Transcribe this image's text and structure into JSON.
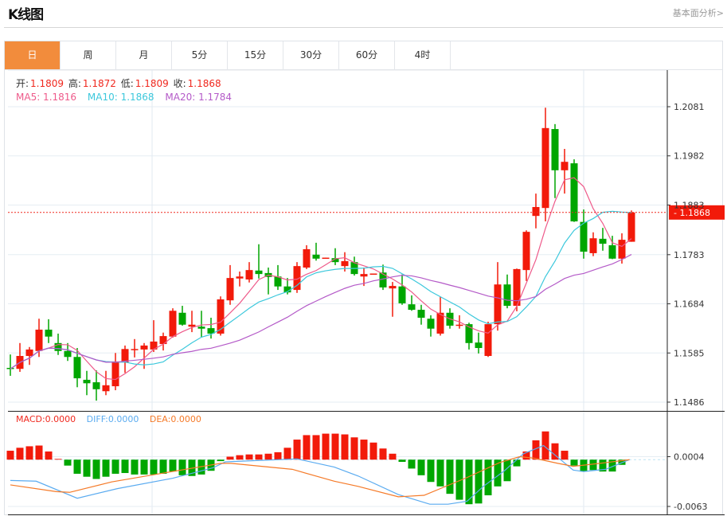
{
  "header": {
    "title": "K线图",
    "link": "基本面分析>"
  },
  "tabs": [
    {
      "label": "日",
      "active": true
    },
    {
      "label": "周"
    },
    {
      "label": "月"
    },
    {
      "label": "5分"
    },
    {
      "label": "15分"
    },
    {
      "label": "30分"
    },
    {
      "label": "60分"
    },
    {
      "label": "4时"
    }
  ],
  "ohlc_info": {
    "open_label": "开:",
    "open": "1.1809",
    "high_label": "高:",
    "high": "1.1872",
    "low_label": "低:",
    "low": "1.1809",
    "close_label": "收:",
    "close": "1.1868"
  },
  "ma_info": {
    "ma5": "MA5: 1.1816",
    "ma10": "MA10: 1.1868",
    "ma20": "MA20: 1.1784"
  },
  "macd_info": {
    "macd": "MACD:0.0000",
    "diff": "DIFF:0.0000",
    "dea": "DEA:0.0000"
  },
  "colors": {
    "up": "#f21a0a",
    "down": "#00a600",
    "ma5": "#ee5a8a",
    "ma10": "#3cc8dc",
    "ma20": "#b45ac8",
    "diff": "#5aabf0",
    "dea": "#f57a28",
    "accent": "#f28c3c"
  },
  "chart_data": [
    {
      "type": "candlestick",
      "ylim": [
        1.1486,
        1.2081
      ],
      "yticks": [
        "1.2081",
        "1.1982",
        "1.1883",
        "1.1783",
        "1.1684",
        "1.1585",
        "1.1486"
      ],
      "current_price": "1.1868",
      "moving_averages": [
        5,
        10,
        20
      ],
      "ohlc": [
        [
          1.1555,
          1.1582,
          1.1539,
          1.1553
        ],
        [
          1.1553,
          1.1605,
          1.1547,
          1.1579
        ],
        [
          1.1579,
          1.1597,
          1.1561,
          1.1592
        ],
        [
          1.1589,
          1.1654,
          1.1577,
          1.1632
        ],
        [
          1.1632,
          1.1653,
          1.1605,
          1.1618
        ],
        [
          1.1605,
          1.1624,
          1.1581,
          1.1589
        ],
        [
          1.1589,
          1.1605,
          1.1569,
          1.1577
        ],
        [
          1.1577,
          1.1595,
          1.1516,
          1.1534
        ],
        [
          1.1531,
          1.1549,
          1.15,
          1.1524
        ],
        [
          1.1526,
          1.155,
          1.1489,
          1.1512
        ],
        [
          1.1508,
          1.1549,
          1.15,
          1.152
        ],
        [
          1.1518,
          1.1585,
          1.151,
          1.1568
        ],
        [
          1.1566,
          1.16,
          1.1545,
          1.1593
        ],
        [
          1.1592,
          1.1613,
          1.1576,
          1.1593
        ],
        [
          1.1592,
          1.1605,
          1.1553,
          1.16
        ],
        [
          1.1592,
          1.1651,
          1.1587,
          1.1608
        ],
        [
          1.1603,
          1.1626,
          1.159,
          1.1619
        ],
        [
          1.1618,
          1.1675,
          1.1616,
          1.167
        ],
        [
          1.1666,
          1.168,
          1.164,
          1.1642
        ],
        [
          1.1638,
          1.167,
          1.1627,
          1.1642
        ],
        [
          1.1638,
          1.167,
          1.1616,
          1.1634
        ],
        [
          1.1635,
          1.1656,
          1.1614,
          1.1624
        ],
        [
          1.1624,
          1.1699,
          1.162,
          1.1693
        ],
        [
          1.1691,
          1.1762,
          1.1682,
          1.1736
        ],
        [
          1.1735,
          1.1749,
          1.1719,
          1.1739
        ],
        [
          1.1733,
          1.1768,
          1.1727,
          1.1752
        ],
        [
          1.1751,
          1.1804,
          1.1735,
          1.1744
        ],
        [
          1.1746,
          1.1757,
          1.1703,
          1.1738
        ],
        [
          1.1739,
          1.1762,
          1.1712,
          1.1719
        ],
        [
          1.1719,
          1.1736,
          1.1703,
          1.1707
        ],
        [
          1.1712,
          1.1768,
          1.1706,
          1.176
        ],
        [
          1.1757,
          1.1802,
          1.1754,
          1.1794
        ],
        [
          1.1783,
          1.1807,
          1.1771,
          1.1775
        ],
        [
          1.1776,
          1.1777,
          1.1776,
          1.1777
        ],
        [
          1.1776,
          1.1796,
          1.1762,
          1.1768
        ],
        [
          1.176,
          1.1788,
          1.1749,
          1.177
        ],
        [
          1.1768,
          1.1779,
          1.1741,
          1.1744
        ],
        [
          1.1739,
          1.1757,
          1.172,
          1.1744
        ],
        [
          1.1744,
          1.1745,
          1.1744,
          1.1745
        ],
        [
          1.1747,
          1.1763,
          1.1712,
          1.1717
        ],
        [
          1.1715,
          1.1728,
          1.1658,
          1.172
        ],
        [
          1.1719,
          1.1743,
          1.1682,
          1.1685
        ],
        [
          1.1683,
          1.1701,
          1.167,
          1.1672
        ],
        [
          1.1672,
          1.1682,
          1.1642,
          1.1656
        ],
        [
          1.1654,
          1.1661,
          1.1618,
          1.1634
        ],
        [
          1.1624,
          1.1698,
          1.162,
          1.1666
        ],
        [
          1.1666,
          1.1675,
          1.1634,
          1.164
        ],
        [
          1.164,
          1.1661,
          1.1634,
          1.1642
        ],
        [
          1.1643,
          1.1646,
          1.1592,
          1.1605
        ],
        [
          1.1606,
          1.1626,
          1.1584,
          1.1595
        ],
        [
          1.1579,
          1.1648,
          1.1577,
          1.1643
        ],
        [
          1.1643,
          1.1768,
          1.163,
          1.1723
        ],
        [
          1.1723,
          1.1743,
          1.1675,
          1.168
        ],
        [
          1.168,
          1.1755,
          1.1669,
          1.1754
        ],
        [
          1.1752,
          1.1832,
          1.173,
          1.1829
        ],
        [
          1.1861,
          1.1906,
          1.1836,
          1.1879
        ],
        [
          1.1877,
          1.2079,
          1.185,
          1.2038
        ],
        [
          1.2036,
          1.2046,
          1.1897,
          1.1953
        ],
        [
          1.1953,
          1.1996,
          1.1906,
          1.197
        ],
        [
          1.1967,
          1.1975,
          1.1849,
          1.185
        ],
        [
          1.1849,
          1.1874,
          1.1775,
          1.1789
        ],
        [
          1.1786,
          1.1828,
          1.178,
          1.1816
        ],
        [
          1.1815,
          1.1837,
          1.1791,
          1.1805
        ],
        [
          1.1802,
          1.1821,
          1.1774,
          1.1775
        ],
        [
          1.1775,
          1.1826,
          1.1765,
          1.1813
        ],
        [
          1.1809,
          1.1872,
          1.1809,
          1.1868
        ]
      ]
    },
    {
      "type": "bar+line",
      "yticks": [
        "0.0004",
        "-0.0063"
      ],
      "ylim": [
        -0.0063,
        0.0004
      ],
      "macd_histogram": [
        0.0012,
        0.0016,
        0.0018,
        0.0019,
        0.0011,
        0.0001,
        -0.0008,
        -0.0019,
        -0.0023,
        -0.0026,
        -0.0023,
        -0.0019,
        -0.0018,
        -0.002,
        -0.002,
        -0.002,
        -0.0019,
        -0.0016,
        -0.0021,
        -0.0022,
        -0.002,
        -0.0015,
        -0.0002,
        0.0004,
        0.0006,
        0.0007,
        0.0007,
        0.0008,
        0.001,
        0.0016,
        0.0027,
        0.0033,
        0.0033,
        0.0035,
        0.0035,
        0.0034,
        0.003,
        0.0027,
        0.0023,
        0.0015,
        0.0008,
        -0.0003,
        -0.0012,
        -0.0021,
        -0.003,
        -0.0036,
        -0.0046,
        -0.0054,
        -0.006,
        -0.0059,
        -0.0048,
        -0.0036,
        -0.0029,
        -0.0009,
        0.0011,
        0.0026,
        0.0038,
        0.0022,
        0.0012,
        -0.0008,
        -0.0016,
        -0.0014,
        -0.0016,
        -0.0016,
        -0.0007,
        0.0
      ],
      "diff": [
        [
          1,
          -0.0028
        ],
        [
          3.7,
          -0.0029
        ],
        [
          8,
          -0.0052
        ],
        [
          12.2,
          -0.0039
        ],
        [
          18,
          -0.0025
        ],
        [
          22.2,
          -0.0011
        ],
        [
          23.5,
          -0.0003
        ],
        [
          31,
          0.0001
        ],
        [
          34.9,
          -0.001
        ],
        [
          37.4,
          -0.0022
        ],
        [
          41.6,
          -0.0047
        ],
        [
          44.9,
          -0.006
        ],
        [
          46.8,
          -0.006
        ],
        [
          48.8,
          -0.0056
        ],
        [
          50.5,
          -0.0036
        ],
        [
          52.7,
          -0.0015
        ],
        [
          54.7,
          0.0008
        ],
        [
          56.8,
          0.0019
        ],
        [
          58.3,
          0.0003
        ],
        [
          59.9,
          -0.0014
        ],
        [
          61,
          -0.0016
        ],
        [
          63.3,
          -0.0013
        ],
        [
          65.8,
          0.0
        ]
      ],
      "dea": [
        [
          1,
          -0.0034
        ],
        [
          5.8,
          -0.0043
        ],
        [
          7.2,
          -0.0044
        ],
        [
          11.6,
          -0.003
        ],
        [
          16.6,
          -0.0019
        ],
        [
          23,
          -0.0005
        ],
        [
          24.1,
          -0.0005
        ],
        [
          30.5,
          -0.0013
        ],
        [
          34.9,
          -0.0029
        ],
        [
          37.4,
          -0.0036
        ],
        [
          41.6,
          -0.005
        ],
        [
          44.3,
          -0.0048
        ],
        [
          48.8,
          -0.0024
        ],
        [
          52.2,
          -0.0004
        ],
        [
          54.3,
          0.0004
        ],
        [
          55.8,
          0.0002
        ],
        [
          58.3,
          -0.0005
        ],
        [
          59.9,
          -0.0009
        ],
        [
          62.7,
          -0.0005
        ],
        [
          65.8,
          0.0
        ]
      ]
    }
  ]
}
